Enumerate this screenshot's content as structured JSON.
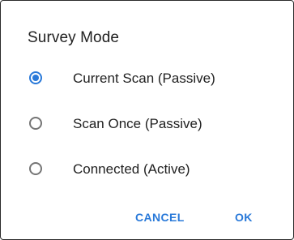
{
  "dialog": {
    "title": "Survey Mode",
    "options": [
      {
        "label": "Current Scan (Passive)",
        "selected": true
      },
      {
        "label": "Scan Once (Passive)",
        "selected": false
      },
      {
        "label": "Connected (Active)",
        "selected": false
      }
    ],
    "buttons": {
      "cancel_label": "CANCEL",
      "ok_label": "OK"
    }
  },
  "colors": {
    "accent": "#2979d9",
    "text": "#212121",
    "radio_unchecked": "#757575"
  }
}
